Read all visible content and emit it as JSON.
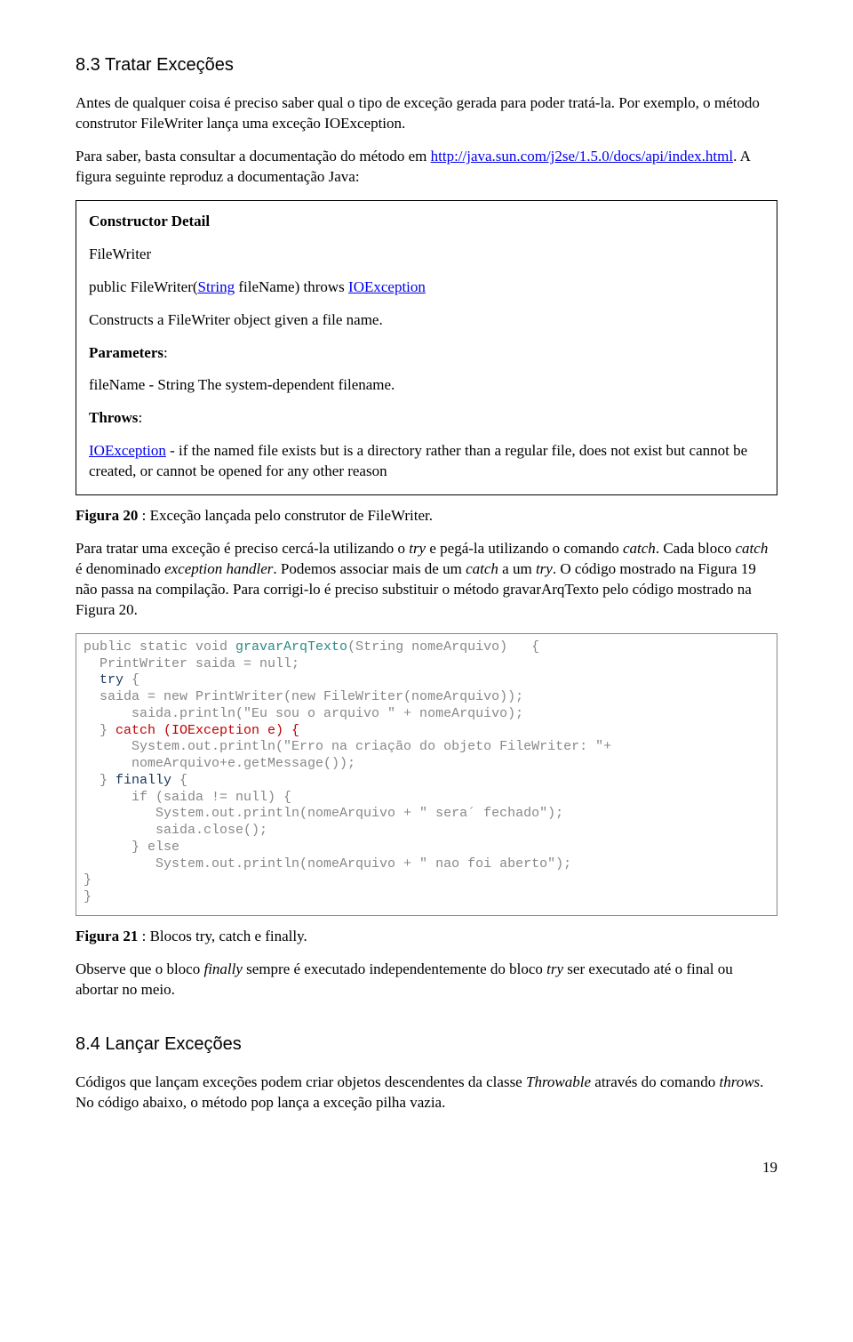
{
  "s83": {
    "heading": "8.3 Tratar Exceções",
    "p1": "Antes de qualquer coisa é preciso saber qual o tipo de exceção gerada para poder tratá-la. Por exemplo, o método construtor FileWriter lança uma exceção IOException.",
    "p2a": "Para saber, basta consultar a documentação do método em ",
    "p2_link": "http://java.sun.com/j2se/1.5.0/docs/api/index.html",
    "p2b": ". A figura seguinte reproduz a documentação Java:"
  },
  "docbox": {
    "cd": "Constructor Detail",
    "fw": "FileWriter",
    "sig_a": "public FileWriter(",
    "sig_link1": "String",
    "sig_b": " fileName) throws ",
    "sig_link2": "IOException",
    "constructs": "Constructs a FileWriter object given a file name.",
    "params_h": "Parameters",
    "params_colon": ":",
    "params_v": "fileName - String The system-dependent filename.",
    "throws_h": "Throws",
    "throws_colon": ":",
    "throws_link": "IOException",
    "throws_rest": " - if the named file exists but is a directory rather than a regular file, does not exist but cannot be created, or cannot be opened for any other reason"
  },
  "fig20": {
    "label": "Figura 20",
    "rest": " : Exceção lançada pelo construtor de FileWriter."
  },
  "para_after": {
    "t1": "Para tratar uma exceção é preciso cercá-la utilizando o ",
    "i1": "try",
    "t2": " e pegá-la utilizando o comando ",
    "i2": "catch",
    "t3": ". Cada bloco ",
    "i3": "catch",
    "t4": " é denominado ",
    "i4": "exception handler",
    "t5": ". Podemos associar mais de um ",
    "i5": "catch",
    "t6": " a um ",
    "i6": "try",
    "t7": ". O código mostrado na Figura 19 não passa na compilação. Para corrigi-lo é preciso substituir o método gravarArqTexto pelo código mostrado na Figura 20."
  },
  "code": {
    "l01a": "public static void ",
    "l01b": "gravarArqTexto",
    "l01c": "(String nomeArquivo)   {",
    "l02": "  PrintWriter saida = null;",
    "l03a": "  ",
    "l03b": "try",
    "l03c": " {",
    "l04": "  saida = new PrintWriter(new FileWriter(nomeArquivo));",
    "l05": "      saida.println(\"Eu sou o arquivo \" + nomeArquivo);",
    "l06a": "  } ",
    "l06b": "catch (IOException e) {",
    "l07": "      System.out.println(\"Erro na criação do objeto FileWriter: \"+",
    "l08": "      nomeArquivo+e.getMessage());",
    "l09a": "  } ",
    "l09b": "finally",
    "l09c": " {",
    "l10": "      if (saida != null) {",
    "l11": "         System.out.println(nomeArquivo + \" sera´ fechado\");",
    "l12": "         saida.close();",
    "l13": "      } else",
    "l14": "         System.out.println(nomeArquivo + \" nao foi aberto\");",
    "l15": "}",
    "l16": "}"
  },
  "fig21": {
    "label": "Figura 21",
    "rest": " : Blocos try, catch e finally."
  },
  "obs": {
    "t1": "Observe que o bloco ",
    "i1": "finally",
    "t2": " sempre é executado independentemente do bloco ",
    "i2": "try",
    "t3": " ser executado até o final ou abortar no meio."
  },
  "s84": {
    "heading": "8.4 Lançar Exceções",
    "p1a": "Códigos que lançam exceções podem criar objetos descendentes da classe ",
    "p1_i": "Throwable",
    "p1b": " através do comando ",
    "p1_i2": "throws",
    "p1c": ". No código abaixo, o método pop lança a exceção pilha vazia."
  },
  "page_num": "19"
}
